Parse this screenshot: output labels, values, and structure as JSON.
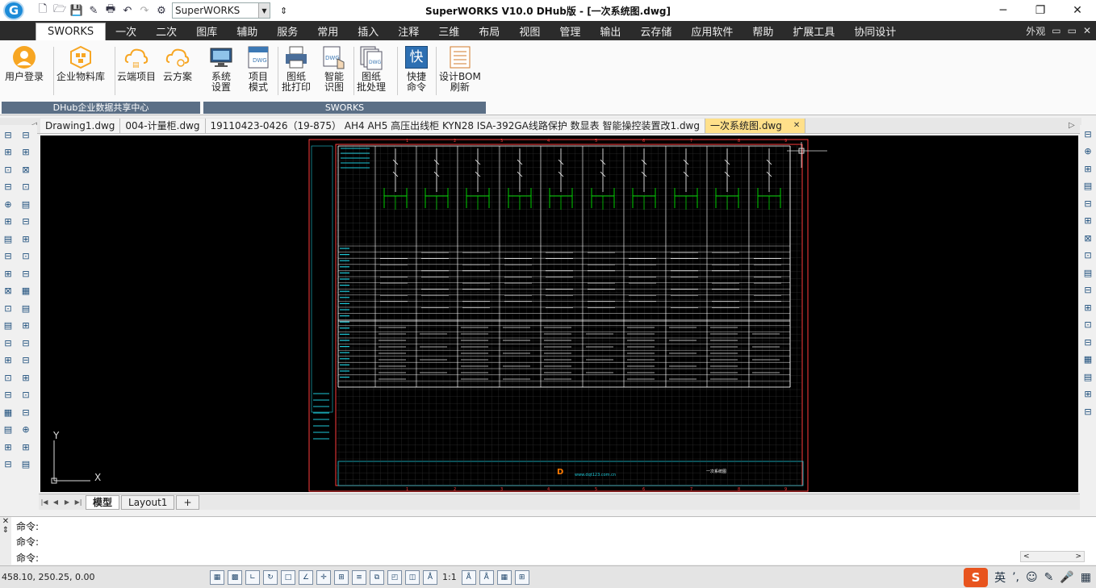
{
  "window": {
    "title": "SuperWORKS V10.0 DHub版 - [一次系统图.dwg]",
    "workspace": "SuperWORKS",
    "qa_more": "⇕",
    "controls": [
      "─",
      "❐",
      "✕"
    ]
  },
  "menu": {
    "active_tab": "SWORKS",
    "items": [
      "一次",
      "二次",
      "图库",
      "辅助",
      "服务",
      "常用",
      "插入",
      "注释",
      "三维",
      "布局",
      "视图",
      "管理",
      "输出",
      "云存储",
      "应用软件",
      "帮助",
      "扩展工具",
      "协同设计"
    ],
    "right_items": [
      "外观",
      "▭",
      "▭",
      "✕"
    ],
    "appearance_label": "外观"
  },
  "ribbon": {
    "group1": {
      "label": "DHub企业数据共享中心",
      "buttons": [
        {
          "label": "用户登录",
          "icon": "user-icon"
        },
        {
          "label": "企业物料库",
          "icon": "materials-icon"
        },
        {
          "label": "云端项目",
          "icon": "cloud-project-icon"
        },
        {
          "label": "云方案",
          "icon": "cloud-plan-icon"
        }
      ]
    },
    "group2": {
      "label": "SWORKS",
      "buttons": [
        {
          "label1": "系统",
          "label2": "设置",
          "icon": "monitor-settings-icon"
        },
        {
          "label1": "项目",
          "label2": "模式",
          "icon": "dwg-project-icon"
        },
        {
          "label1": "图纸",
          "label2": "批打印",
          "icon": "printer-icon"
        },
        {
          "label1": "智能",
          "label2": "识图",
          "icon": "smart-recognize-icon"
        },
        {
          "label1": "图纸",
          "label2": "批处理",
          "icon": "batch-process-icon"
        },
        {
          "label1": "快捷",
          "label2": "命令",
          "icon": "quick-command-icon"
        },
        {
          "label1": "设计BOM",
          "label2": "刷新",
          "icon": "bom-refresh-icon"
        }
      ],
      "quick_icon_text": "快"
    }
  },
  "doc_tabs": [
    "Drawing1.dwg",
    "004-计量柜.dwg",
    "19110423-0426（19-875） AH4 AH5 高压出线柜  KYN28  ISA-392GA线路保护  数显表 智能操控装置改1.dwg",
    "一次系统图.dwg"
  ],
  "doc_tab_active_index": 3,
  "layout_tabs": [
    "模型",
    "Layout1",
    "+"
  ],
  "command_lines": [
    "命令:",
    "命令:",
    "命令:"
  ],
  "status": {
    "coords": "458.10, 250.25, 0.00",
    "scale": "1:1"
  },
  "axis": {
    "y": "Y",
    "x": "X"
  },
  "drawing": {
    "column_numbers": [
      "1",
      "2",
      "3",
      "4",
      "5",
      "6",
      "7",
      "8",
      "9"
    ],
    "title_block_company": "www.dqt123.com.cn",
    "title_block_name": "一次系统图",
    "logo_text": "D"
  },
  "ime": {
    "logo": "S",
    "mode": "英",
    "punct": "’,",
    "icons": [
      "☺",
      "✎",
      "🎤",
      "▦"
    ]
  },
  "colors": {
    "menubar": "#2b2b2b",
    "canvas": "#000000",
    "drawing_border": "#ff3b3b",
    "drawing_lines": "#ffffff",
    "cyan": "#1ec9d8",
    "green": "#00d000",
    "active_tab": "#ffe08a"
  }
}
